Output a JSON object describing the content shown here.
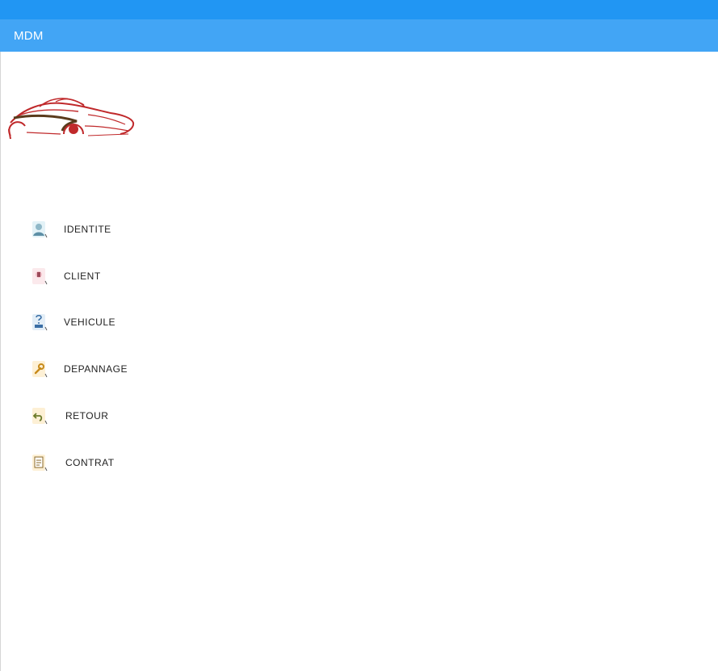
{
  "app_bar": {
    "title": "MDM"
  },
  "colors": {
    "status_bar": "#2196f3",
    "app_bar": "#42a5f5",
    "logo_red": "#c0292b",
    "logo_dark": "#5a3b1c"
  },
  "menu": {
    "items": [
      {
        "label": "IDENTITE",
        "icon": "identity-icon"
      },
      {
        "label": "CLIENT",
        "icon": "client-icon"
      },
      {
        "label": "VEHICULE",
        "icon": "vehicle-icon"
      },
      {
        "label": "DEPANNAGE",
        "icon": "wrench-icon"
      },
      {
        "label": "RETOUR",
        "icon": "return-icon"
      },
      {
        "label": "CONTRAT",
        "icon": "contract-icon"
      }
    ]
  }
}
